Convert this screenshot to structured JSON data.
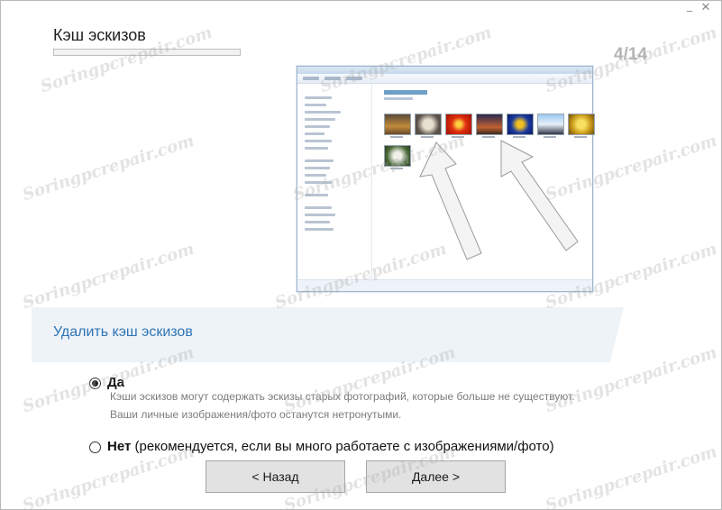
{
  "window": {
    "minimize_label": "_",
    "close_label": "✕"
  },
  "header": {
    "title": "Кэш эскизов",
    "step": "4/14",
    "progress_fraction": 0.0
  },
  "banner": {
    "text": "Удалить кэш эскизов"
  },
  "options": [
    {
      "label": "Да",
      "selected": true,
      "description_line1": "Кэши эскизов могут содержать эскизы старых фотографий, которые больше не существуют.",
      "description_line2": "Ваши личные изображения/фото останутся нетронутыми."
    },
    {
      "label": "Нет",
      "note": " (рекомендуется, если вы много работаете с изображениями/фото)",
      "selected": false
    }
  ],
  "buttons": {
    "back": "< Назад",
    "next": "Далее >"
  },
  "watermark": "Soringpcrepair.com",
  "colors": {
    "accent": "#2e74b5",
    "banner_bg": "#eef3f8",
    "button_bg": "#e2e2e2"
  }
}
